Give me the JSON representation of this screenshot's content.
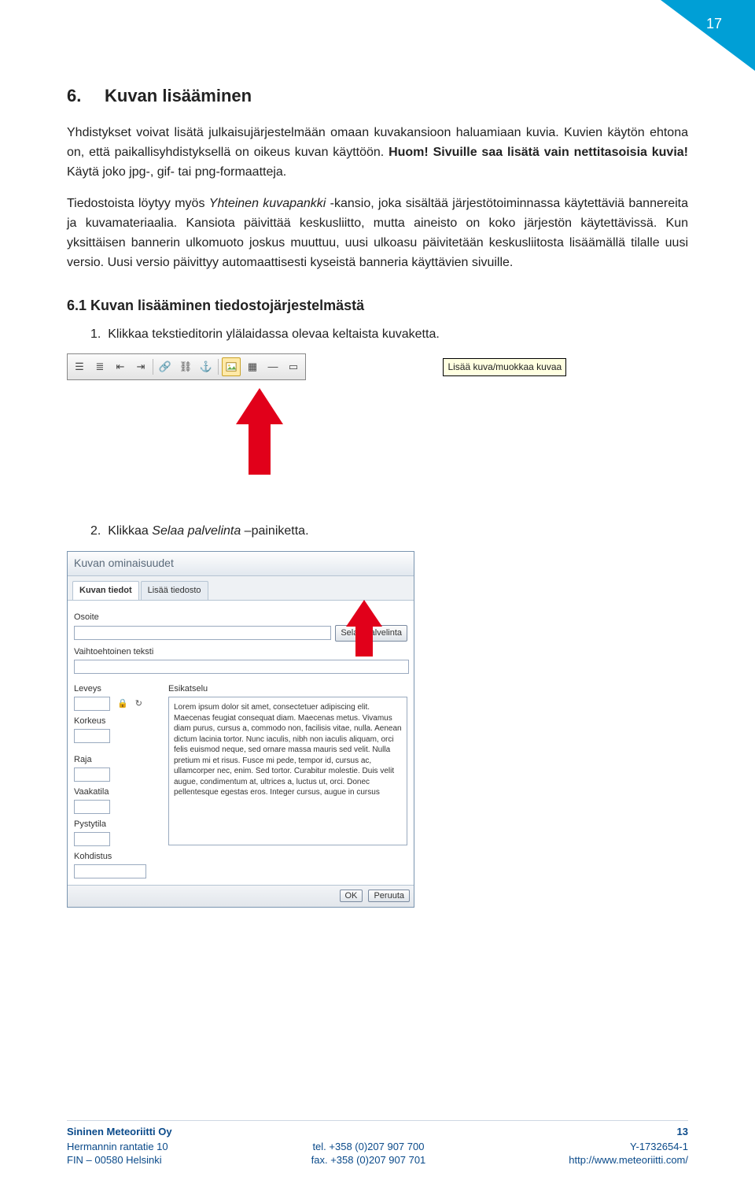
{
  "page_number_corner": "17",
  "heading": {
    "num": "6.",
    "title": "Kuvan lisääminen"
  },
  "para1_a": "Yhdistykset voivat lisätä julkaisujärjestelmään omaan kuvakansioon haluamiaan kuvia. Kuvien käytön ehtona on, että paikallisyhdistyksellä on oikeus kuvan käyttöön. ",
  "para1_b_bold": "Huom! Sivuille saa lisätä vain nettitasoisia kuvia!",
  "para1_c": " Käytä joko jpg-, gif- tai png-formaatteja.",
  "para2_a": "Tiedostoista löytyy myös ",
  "para2_em": "Yhteinen kuvapankki",
  "para2_b": " -kansio, joka sisältää järjestötoiminnassa käytettäviä bannereita ja kuvamateriaalia. Kansiota päivittää keskusliitto, mutta aineisto on koko järjestön käytettävissä. Kun yksittäisen bannerin ulkomuoto joskus muuttuu, uusi ulkoasu päivitetään keskusliitosta lisäämällä tilalle uusi versio. Uusi versio päivittyy automaattisesti kyseistä banneria käyttävien sivuille.",
  "sub_heading": "6.1 Kuvan lisääminen tiedostojärjestelmästä",
  "step1": "Klikkaa tekstieditorin ylälaidassa olevaa keltaista kuvaketta.",
  "step2_a": "Klikkaa ",
  "step2_em": "Selaa palvelinta",
  "step2_b": " –painiketta.",
  "toolbar_tooltip": "Lisää kuva/muokkaa kuvaa",
  "dialog": {
    "title": "Kuvan ominaisuudet",
    "tab1": "Kuvan tiedot",
    "tab2": "Lisää tiedosto",
    "lbl_url": "Osoite",
    "btn_browse": "Selaa palvelinta",
    "lbl_alt": "Vaihtoehtoinen teksti",
    "lbl_w": "Leveys",
    "lbl_h": "Korkeus",
    "lbl_border": "Raja",
    "lbl_hspace": "Vaakatila",
    "lbl_vspace": "Pystytila",
    "lbl_align": "Kohdistus",
    "lbl_preview": "Esikatselu",
    "preview_text": "Lorem ipsum dolor sit amet, consectetuer adipiscing elit. Maecenas feugiat consequat diam. Maecenas metus. Vivamus diam purus, cursus a, commodo non, facilisis vitae, nulla. Aenean dictum lacinia tortor. Nunc iaculis, nibh non iaculis aliquam, orci felis euismod neque, sed ornare massa mauris sed velit. Nulla pretium mi et risus. Fusce mi pede, tempor id, cursus ac, ullamcorper nec, enim. Sed tortor. Curabitur molestie. Duis velit augue, condimentum at, ultrices a, luctus ut, orci. Donec pellentesque egestas eros. Integer cursus, augue in cursus",
    "btn_ok": "OK",
    "btn_cancel": "Peruuta"
  },
  "footer": {
    "company": "Sininen Meteoriitti Oy",
    "page": "13",
    "addr1": "Hermannin rantatie 10",
    "addr2": "FIN – 00580 Helsinki",
    "tel": "tel.  +358 (0)207 907 700",
    "fax": "fax. +358 (0)207 907 701",
    "reg": "Y-1732654-1",
    "url": "http://www.meteoriitti.com/"
  }
}
